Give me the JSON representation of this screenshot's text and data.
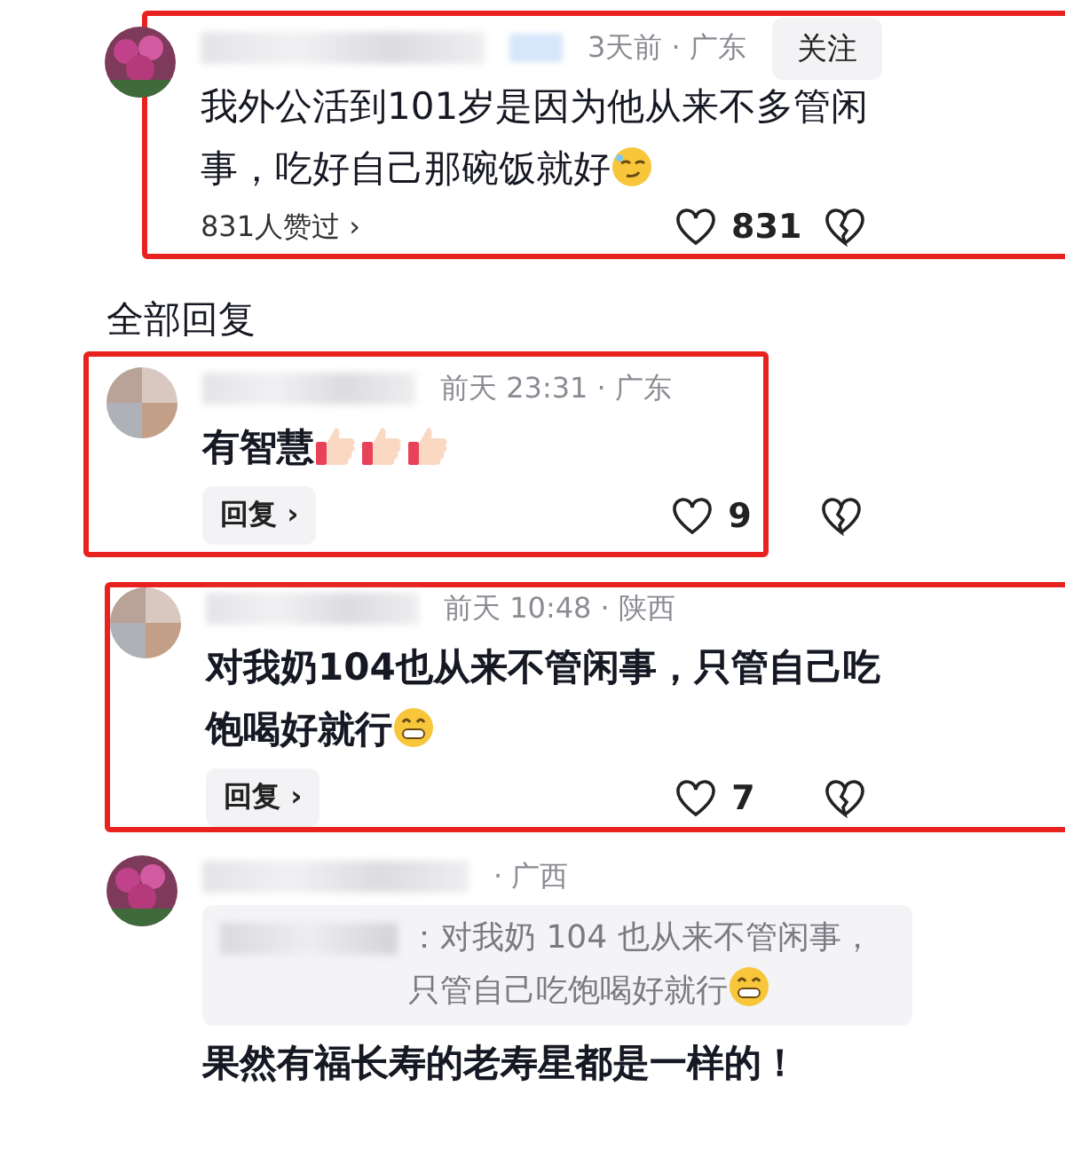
{
  "comment": {
    "highlighted": true,
    "avatar": {
      "kind": "flower"
    },
    "meta": "3天前 · 广东",
    "follow_button": "关注",
    "text": "我外公活到101岁是因为他从来不多管闲事，吃好自己那碗饭就好",
    "emojis": [
      {
        "kind": "smirk"
      }
    ],
    "likes_summary": "831人赞过 ›",
    "likes": "831"
  },
  "replies_heading": "全部回复",
  "replies": [
    {
      "highlighted": true,
      "avatar": {
        "kind": "photo"
      },
      "meta": "前天 23:31 · 广东",
      "text": "有智慧",
      "emojis": [
        {
          "kind": "thumbs"
        },
        {
          "kind": "thumbs"
        },
        {
          "kind": "thumbs"
        }
      ],
      "reply_button": "回复 ›",
      "likes": "9"
    },
    {
      "highlighted": true,
      "avatar": {
        "kind": "photo"
      },
      "meta": "前天 10:48 · 陕西",
      "text": "对我奶104也从来不管闲事，只管自己吃饱喝好就行",
      "emojis": [
        {
          "kind": "grin"
        }
      ],
      "reply_button": "回复 ›",
      "likes": "7"
    },
    {
      "highlighted": false,
      "avatar": {
        "kind": "flower"
      },
      "meta": "· 广西",
      "quote": {
        "text": "：对我奶 104 也从来不管闲事，只管自己吃饱喝好就行",
        "emojis": [
          {
            "kind": "grin"
          }
        ]
      },
      "text": "果然有福长寿的老寿星都是一样的！"
    }
  ]
}
